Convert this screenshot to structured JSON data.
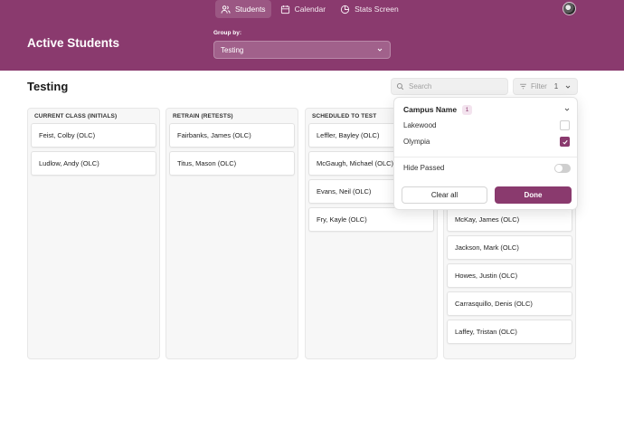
{
  "nav": {
    "items": [
      {
        "label": "Students",
        "icon": "users-icon",
        "active": true
      },
      {
        "label": "Calendar",
        "icon": "calendar-icon",
        "active": false
      },
      {
        "label": "Stats Screen",
        "icon": "pie-chart-icon",
        "active": false
      }
    ]
  },
  "header": {
    "title": "Active Students",
    "group_by_label": "Group by:",
    "group_by_value": "Testing",
    "accent_color": "#8a3a6e"
  },
  "toolbar": {
    "page_title": "Testing",
    "search_placeholder": "Search",
    "filter_label": "Filter",
    "filter_count": "1"
  },
  "columns": [
    {
      "title": "CURRENT CLASS (INITIALS)",
      "cards": [
        "Feist, Colby (OLC)",
        "Ludlow, Andy (OLC)"
      ]
    },
    {
      "title": "RETRAIN (RETESTS)",
      "cards": [
        "Fairbanks, James (OLC)",
        "Titus, Mason (OLC)"
      ]
    },
    {
      "title": "SCHEDULED TO TEST",
      "cards": [
        "Leffler, Bayley (OLC)",
        "McGaugh, Michael (OLC)",
        "Evans, Neil (OLC)",
        "Fry, Kayle (OLC)"
      ]
    },
    {
      "title": "",
      "cards": [
        "McKay, James (OLC)",
        "Jackson, Mark (OLC)",
        "Howes, Justin (OLC)",
        "Carrasquillo, Denis (OLC)",
        "Laffey, Tristan (OLC)"
      ]
    }
  ],
  "filter_panel": {
    "section_title": "Campus Name",
    "selected_count": "1",
    "options": [
      {
        "label": "Lakewood",
        "checked": false
      },
      {
        "label": "Olympia",
        "checked": true
      }
    ],
    "toggle_label": "Hide Passed",
    "toggle_on": false,
    "clear_label": "Clear all",
    "done_label": "Done"
  }
}
